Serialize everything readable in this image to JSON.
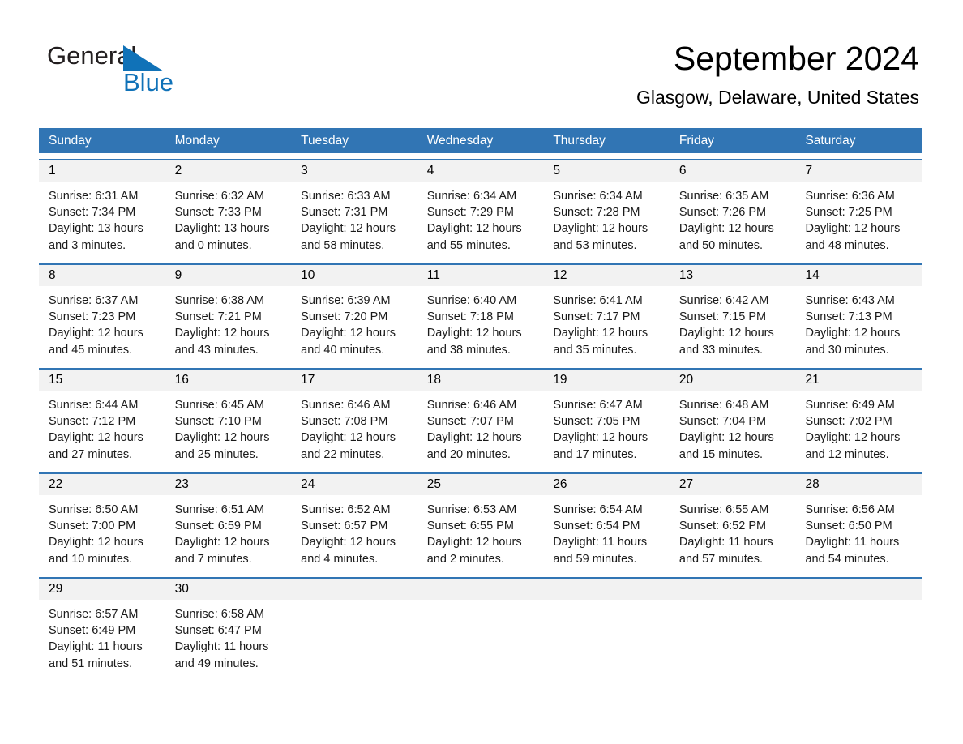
{
  "brand": {
    "name_top": "General",
    "name_bottom": "Blue",
    "triangle_color": "#1072b8",
    "text_color": "#231f20"
  },
  "header": {
    "month_title": "September 2024",
    "location": "Glasgow, Delaware, United States"
  },
  "theme": {
    "header_blue": "#3175b4",
    "daynum_band": "#f2f2f2",
    "page_background": "#ffffff",
    "text": "#000000"
  },
  "weekdays": [
    "Sunday",
    "Monday",
    "Tuesday",
    "Wednesday",
    "Thursday",
    "Friday",
    "Saturday"
  ],
  "weeks": [
    [
      {
        "day": "1",
        "sunrise": "Sunrise: 6:31 AM",
        "sunset": "Sunset: 7:34 PM",
        "daylight_l1": "Daylight: 13 hours",
        "daylight_l2": "and 3 minutes."
      },
      {
        "day": "2",
        "sunrise": "Sunrise: 6:32 AM",
        "sunset": "Sunset: 7:33 PM",
        "daylight_l1": "Daylight: 13 hours",
        "daylight_l2": "and 0 minutes."
      },
      {
        "day": "3",
        "sunrise": "Sunrise: 6:33 AM",
        "sunset": "Sunset: 7:31 PM",
        "daylight_l1": "Daylight: 12 hours",
        "daylight_l2": "and 58 minutes."
      },
      {
        "day": "4",
        "sunrise": "Sunrise: 6:34 AM",
        "sunset": "Sunset: 7:29 PM",
        "daylight_l1": "Daylight: 12 hours",
        "daylight_l2": "and 55 minutes."
      },
      {
        "day": "5",
        "sunrise": "Sunrise: 6:34 AM",
        "sunset": "Sunset: 7:28 PM",
        "daylight_l1": "Daylight: 12 hours",
        "daylight_l2": "and 53 minutes."
      },
      {
        "day": "6",
        "sunrise": "Sunrise: 6:35 AM",
        "sunset": "Sunset: 7:26 PM",
        "daylight_l1": "Daylight: 12 hours",
        "daylight_l2": "and 50 minutes."
      },
      {
        "day": "7",
        "sunrise": "Sunrise: 6:36 AM",
        "sunset": "Sunset: 7:25 PM",
        "daylight_l1": "Daylight: 12 hours",
        "daylight_l2": "and 48 minutes."
      }
    ],
    [
      {
        "day": "8",
        "sunrise": "Sunrise: 6:37 AM",
        "sunset": "Sunset: 7:23 PM",
        "daylight_l1": "Daylight: 12 hours",
        "daylight_l2": "and 45 minutes."
      },
      {
        "day": "9",
        "sunrise": "Sunrise: 6:38 AM",
        "sunset": "Sunset: 7:21 PM",
        "daylight_l1": "Daylight: 12 hours",
        "daylight_l2": "and 43 minutes."
      },
      {
        "day": "10",
        "sunrise": "Sunrise: 6:39 AM",
        "sunset": "Sunset: 7:20 PM",
        "daylight_l1": "Daylight: 12 hours",
        "daylight_l2": "and 40 minutes."
      },
      {
        "day": "11",
        "sunrise": "Sunrise: 6:40 AM",
        "sunset": "Sunset: 7:18 PM",
        "daylight_l1": "Daylight: 12 hours",
        "daylight_l2": "and 38 minutes."
      },
      {
        "day": "12",
        "sunrise": "Sunrise: 6:41 AM",
        "sunset": "Sunset: 7:17 PM",
        "daylight_l1": "Daylight: 12 hours",
        "daylight_l2": "and 35 minutes."
      },
      {
        "day": "13",
        "sunrise": "Sunrise: 6:42 AM",
        "sunset": "Sunset: 7:15 PM",
        "daylight_l1": "Daylight: 12 hours",
        "daylight_l2": "and 33 minutes."
      },
      {
        "day": "14",
        "sunrise": "Sunrise: 6:43 AM",
        "sunset": "Sunset: 7:13 PM",
        "daylight_l1": "Daylight: 12 hours",
        "daylight_l2": "and 30 minutes."
      }
    ],
    [
      {
        "day": "15",
        "sunrise": "Sunrise: 6:44 AM",
        "sunset": "Sunset: 7:12 PM",
        "daylight_l1": "Daylight: 12 hours",
        "daylight_l2": "and 27 minutes."
      },
      {
        "day": "16",
        "sunrise": "Sunrise: 6:45 AM",
        "sunset": "Sunset: 7:10 PM",
        "daylight_l1": "Daylight: 12 hours",
        "daylight_l2": "and 25 minutes."
      },
      {
        "day": "17",
        "sunrise": "Sunrise: 6:46 AM",
        "sunset": "Sunset: 7:08 PM",
        "daylight_l1": "Daylight: 12 hours",
        "daylight_l2": "and 22 minutes."
      },
      {
        "day": "18",
        "sunrise": "Sunrise: 6:46 AM",
        "sunset": "Sunset: 7:07 PM",
        "daylight_l1": "Daylight: 12 hours",
        "daylight_l2": "and 20 minutes."
      },
      {
        "day": "19",
        "sunrise": "Sunrise: 6:47 AM",
        "sunset": "Sunset: 7:05 PM",
        "daylight_l1": "Daylight: 12 hours",
        "daylight_l2": "and 17 minutes."
      },
      {
        "day": "20",
        "sunrise": "Sunrise: 6:48 AM",
        "sunset": "Sunset: 7:04 PM",
        "daylight_l1": "Daylight: 12 hours",
        "daylight_l2": "and 15 minutes."
      },
      {
        "day": "21",
        "sunrise": "Sunrise: 6:49 AM",
        "sunset": "Sunset: 7:02 PM",
        "daylight_l1": "Daylight: 12 hours",
        "daylight_l2": "and 12 minutes."
      }
    ],
    [
      {
        "day": "22",
        "sunrise": "Sunrise: 6:50 AM",
        "sunset": "Sunset: 7:00 PM",
        "daylight_l1": "Daylight: 12 hours",
        "daylight_l2": "and 10 minutes."
      },
      {
        "day": "23",
        "sunrise": "Sunrise: 6:51 AM",
        "sunset": "Sunset: 6:59 PM",
        "daylight_l1": "Daylight: 12 hours",
        "daylight_l2": "and 7 minutes."
      },
      {
        "day": "24",
        "sunrise": "Sunrise: 6:52 AM",
        "sunset": "Sunset: 6:57 PM",
        "daylight_l1": "Daylight: 12 hours",
        "daylight_l2": "and 4 minutes."
      },
      {
        "day": "25",
        "sunrise": "Sunrise: 6:53 AM",
        "sunset": "Sunset: 6:55 PM",
        "daylight_l1": "Daylight: 12 hours",
        "daylight_l2": "and 2 minutes."
      },
      {
        "day": "26",
        "sunrise": "Sunrise: 6:54 AM",
        "sunset": "Sunset: 6:54 PM",
        "daylight_l1": "Daylight: 11 hours",
        "daylight_l2": "and 59 minutes."
      },
      {
        "day": "27",
        "sunrise": "Sunrise: 6:55 AM",
        "sunset": "Sunset: 6:52 PM",
        "daylight_l1": "Daylight: 11 hours",
        "daylight_l2": "and 57 minutes."
      },
      {
        "day": "28",
        "sunrise": "Sunrise: 6:56 AM",
        "sunset": "Sunset: 6:50 PM",
        "daylight_l1": "Daylight: 11 hours",
        "daylight_l2": "and 54 minutes."
      }
    ],
    [
      {
        "day": "29",
        "sunrise": "Sunrise: 6:57 AM",
        "sunset": "Sunset: 6:49 PM",
        "daylight_l1": "Daylight: 11 hours",
        "daylight_l2": "and 51 minutes."
      },
      {
        "day": "30",
        "sunrise": "Sunrise: 6:58 AM",
        "sunset": "Sunset: 6:47 PM",
        "daylight_l1": "Daylight: 11 hours",
        "daylight_l2": "and 49 minutes."
      },
      {
        "day": "",
        "sunrise": "",
        "sunset": "",
        "daylight_l1": "",
        "daylight_l2": ""
      },
      {
        "day": "",
        "sunrise": "",
        "sunset": "",
        "daylight_l1": "",
        "daylight_l2": ""
      },
      {
        "day": "",
        "sunrise": "",
        "sunset": "",
        "daylight_l1": "",
        "daylight_l2": ""
      },
      {
        "day": "",
        "sunrise": "",
        "sunset": "",
        "daylight_l1": "",
        "daylight_l2": ""
      },
      {
        "day": "",
        "sunrise": "",
        "sunset": "",
        "daylight_l1": "",
        "daylight_l2": ""
      }
    ]
  ]
}
